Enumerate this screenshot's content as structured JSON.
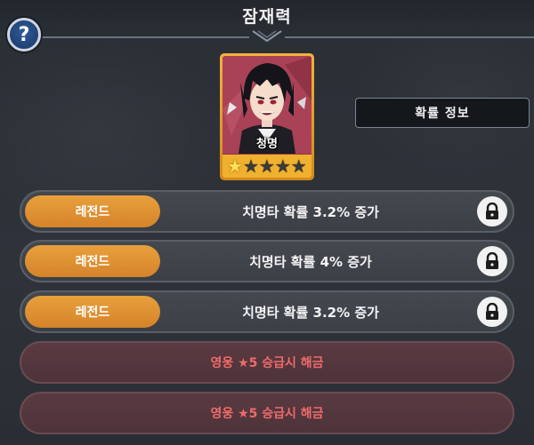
{
  "header": {
    "title": "잠재력",
    "help_label": "?",
    "help_icon": "question-mark-icon"
  },
  "hero_card": {
    "name": "청명",
    "star_count": 1,
    "max_stars": 5,
    "frame_color": "#f0b030",
    "background_color": "#9d3a4c"
  },
  "probability_button": {
    "label": "확률 정보"
  },
  "potential_slots": [
    {
      "grade": "레전드",
      "effect": "치명타 확률 3.2% 증가",
      "lock_icon": "padlock-icon"
    },
    {
      "grade": "레전드",
      "effect": "치명타 확률 4% 증가",
      "lock_icon": "padlock-icon"
    },
    {
      "grade": "레전드",
      "effect": "치명타 확률 3.2% 증가",
      "lock_icon": "padlock-icon"
    }
  ],
  "locked_slots": [
    {
      "text": "영웅 ★5 승급시 해금"
    },
    {
      "text": "영웅 ★5 승급시 해금"
    }
  ],
  "colors": {
    "grade_legend": "#e09434",
    "locked_text": "#ee6b6b",
    "background": "#2c3138"
  }
}
